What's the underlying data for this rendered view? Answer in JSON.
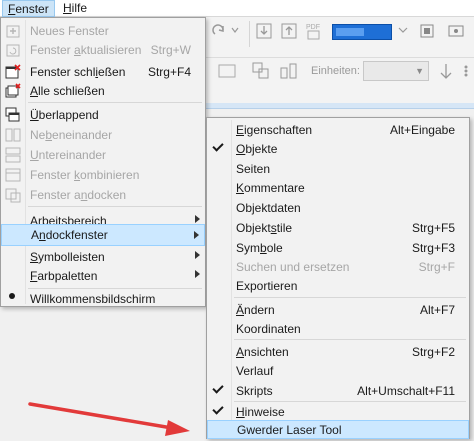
{
  "menubar": {
    "items": [
      {
        "label": "Fenster",
        "ul": "F",
        "rest": "enster"
      },
      {
        "label": "Hilfe",
        "ul": "H",
        "rest": "ilfe"
      }
    ]
  },
  "toolbar": {
    "units_label": "Einheiten:"
  },
  "fenster_menu": {
    "items": [
      {
        "pre": "",
        "ul": "",
        "post": "Neues Fenster",
        "shortcut": ""
      },
      {
        "pre": "Fenster ",
        "ul": "a",
        "post": "ktualisieren",
        "shortcut": "Strg+W"
      },
      {
        "pre": "Fenster schl",
        "ul": "i",
        "post": "eßen",
        "shortcut": "Strg+F4"
      },
      {
        "pre": "",
        "ul": "A",
        "post": "lle schließen",
        "shortcut": ""
      },
      {
        "pre": "",
        "ul": "Ü",
        "post": "berlappend",
        "shortcut": ""
      },
      {
        "pre": "Ne",
        "ul": "b",
        "post": "eneinander",
        "shortcut": ""
      },
      {
        "pre": "",
        "ul": "U",
        "post": "ntereinander",
        "shortcut": ""
      },
      {
        "pre": "Fenster ",
        "ul": "k",
        "post": "ombinieren",
        "shortcut": ""
      },
      {
        "pre": "Fenster a",
        "ul": "n",
        "post": "docken",
        "shortcut": ""
      },
      {
        "pre": "",
        "ul": "A",
        "post": "rbeitsbereich",
        "shortcut": ""
      },
      {
        "pre": "A",
        "ul": "n",
        "post": "dockfenster",
        "shortcut": ""
      },
      {
        "pre": "",
        "ul": "S",
        "post": "ymbolleisten",
        "shortcut": ""
      },
      {
        "pre": "",
        "ul": "F",
        "post": "arbpaletten",
        "shortcut": ""
      },
      {
        "pre": "Willkommensbildschirm",
        "ul": "",
        "post": "",
        "shortcut": ""
      }
    ]
  },
  "andock_menu": {
    "items": [
      {
        "pre": "",
        "ul": "E",
        "post": "igenschaften",
        "shortcut": "Alt+Eingabe"
      },
      {
        "pre": "",
        "ul": "O",
        "post": "bjekte",
        "shortcut": ""
      },
      {
        "pre": "Seiten",
        "ul": "",
        "post": "",
        "shortcut": ""
      },
      {
        "pre": "",
        "ul": "K",
        "post": "ommentare",
        "shortcut": ""
      },
      {
        "pre": "Objektdaten",
        "ul": "",
        "post": "",
        "shortcut": ""
      },
      {
        "pre": "Objekt",
        "ul": "s",
        "post": "tile",
        "shortcut": "Strg+F5"
      },
      {
        "pre": "Sym",
        "ul": "b",
        "post": "ole",
        "shortcut": "Strg+F3"
      },
      {
        "pre": "Suchen und ersetzen",
        "ul": "",
        "post": "",
        "shortcut": "Strg+F"
      },
      {
        "pre": "Exportieren",
        "ul": "",
        "post": "",
        "shortcut": ""
      },
      {
        "pre": "",
        "ul": "Ä",
        "post": "ndern",
        "shortcut": "Alt+F7"
      },
      {
        "pre": "Koordinaten",
        "ul": "",
        "post": "",
        "shortcut": ""
      },
      {
        "pre": "",
        "ul": "A",
        "post": "nsichten",
        "shortcut": "Strg+F2"
      },
      {
        "pre": "Verlauf",
        "ul": "",
        "post": "",
        "shortcut": ""
      },
      {
        "pre": "Skripts",
        "ul": "",
        "post": "",
        "shortcut": "Alt+Umschalt+F11"
      },
      {
        "pre": "",
        "ul": "H",
        "post": "inweise",
        "shortcut": ""
      },
      {
        "pre": "Gwerder Laser Tool",
        "ul": "",
        "post": "",
        "shortcut": ""
      }
    ]
  },
  "colors": {
    "highlight": "#cce8ff",
    "annotation_arrow": "#e23a3a"
  }
}
